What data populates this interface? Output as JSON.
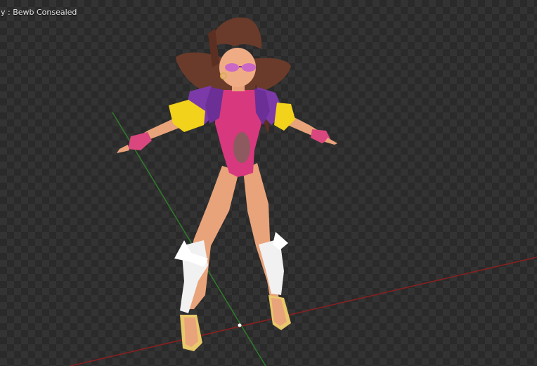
{
  "viewport": {
    "overlay_text": "dy : Bewb Consealed",
    "render_mode": "rendered-preview",
    "background_pattern": "transparent-checkerboard"
  },
  "axes": {
    "x_axis_color": "#8a1f1f",
    "y_axis_color": "#2f7a2a",
    "origin_marker_color": "#ffffff"
  },
  "model": {
    "subject": "cartoon-female-character-a-pose",
    "colors": {
      "skin": "#e9a37a",
      "hair": "#6a3b2a",
      "bodysuit": "#d8387d",
      "jacket": "#7c3aa8",
      "jacket_cuffs": "#f2d21a",
      "glasses": "#c45ad0",
      "leg_wraps": "#f1f1f1",
      "sandals": "#e8c86a"
    }
  }
}
